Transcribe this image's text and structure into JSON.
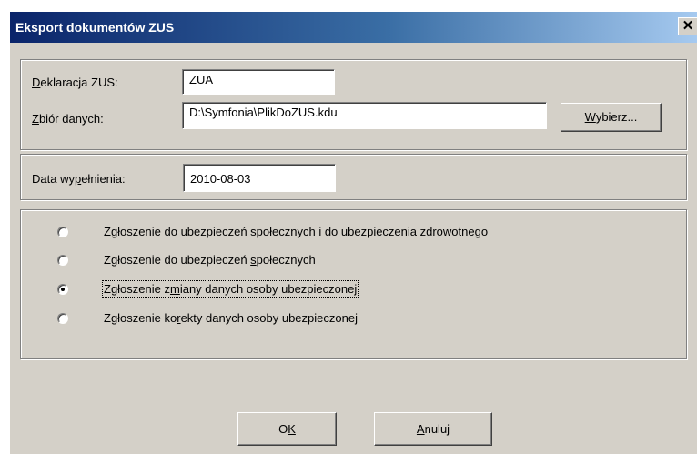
{
  "window": {
    "title": "Eksport dokumentów ZUS",
    "close_symbol": "✕"
  },
  "declaration": {
    "label_first": "D",
    "label_rest": "eklaracja ZUS:",
    "value": "ZUA"
  },
  "dataset": {
    "label_first": "Z",
    "label_rest": "biór danych:",
    "value": "D:\\Symfonia\\PlikDoZUS.kdu",
    "button_first": "W",
    "button_rest": "ybierz..."
  },
  "fill_date": {
    "label_a": "Data wy",
    "label_u": "p",
    "label_b": "ełnienia:",
    "value": "2010-08-03"
  },
  "options": [
    {
      "a": "Zgłoszenie do ",
      "u": "u",
      "b": "bezpieczeń społecznych i do ubezpieczenia zdrowotnego",
      "selected": false
    },
    {
      "a": "Zgłoszenie do ubezpieczeń ",
      "u": "s",
      "b": "połecznych",
      "selected": false
    },
    {
      "a": "Zgłoszenie z",
      "u": "m",
      "b": "iany danych osoby ubezpieczonej",
      "selected": true
    },
    {
      "a": "Zgłoszenie ko",
      "u": "r",
      "b": "ekty danych osoby ubezpieczonej",
      "selected": false
    }
  ],
  "buttons": {
    "ok_a": "O",
    "ok_u": "K",
    "cancel_u": "A",
    "cancel_b": "nuluj"
  }
}
